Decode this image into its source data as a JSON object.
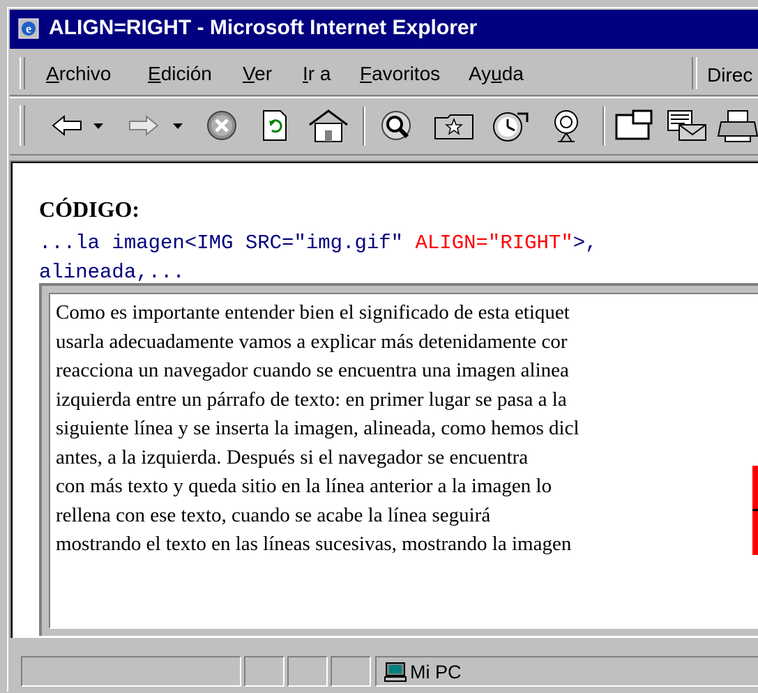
{
  "window": {
    "title": "ALIGN=RIGHT - Microsoft Internet Explorer",
    "title_bg": "#000080"
  },
  "menubar": {
    "items": [
      {
        "label": "Archivo",
        "accel": "A",
        "rest": "rchivo"
      },
      {
        "label": "Edición",
        "accel": "E",
        "rest": "dición"
      },
      {
        "label": "Ver",
        "accel": "V",
        "rest": "er"
      },
      {
        "label": "Ir a",
        "accel": "I",
        "rest": "r a"
      },
      {
        "label": "Favoritos",
        "accel": "F",
        "rest": "avoritos"
      },
      {
        "label": "Ayuda",
        "pre": "Ay",
        "accel": "u",
        "rest": "da"
      }
    ],
    "address_label": "Direc"
  },
  "toolbar": {
    "icons": [
      "back-arrow-icon",
      "forward-arrow-icon",
      "stop-icon",
      "refresh-icon",
      "home-icon",
      "search-icon",
      "favorites-icon",
      "history-icon",
      "channels-icon",
      "fullscreen-icon",
      "mail-icon",
      "print-icon"
    ]
  },
  "page": {
    "heading": "CÓDIGO:",
    "code_line1_a": "...la imagen<IMG SRC=\"img.gif\" ",
    "code_line1_b": "ALIGN=\"RIGHT\"",
    "code_line1_c": ">,",
    "code_line2": "alineada,...",
    "code_color": "#000080",
    "highlight_color": "#ff0000",
    "paragraph_lines": [
      "Como es importante entender bien el significado de esta etiquet",
      "usarla adecuadamente vamos a explicar más detenidamente cor",
      "reacciona un navegador cuando se encuentra una imagen alinea",
      "izquierda entre un párrafo de texto: en primer lugar se pasa a la",
      "siguiente línea y se inserta la imagen, alineada, como hemos dicl",
      "antes, a la izquierda. Después si el navegador se encuentra",
      "con más texto y queda sitio en la línea anterior a la imagen lo",
      "rellena con ese texto, cuando se acabe la línea seguirá",
      "mostrando el texto en las líneas sucesivas, mostrando la imagen"
    ],
    "image_color": "#ff0000"
  },
  "statusbar": {
    "zone": "Mi PC"
  }
}
